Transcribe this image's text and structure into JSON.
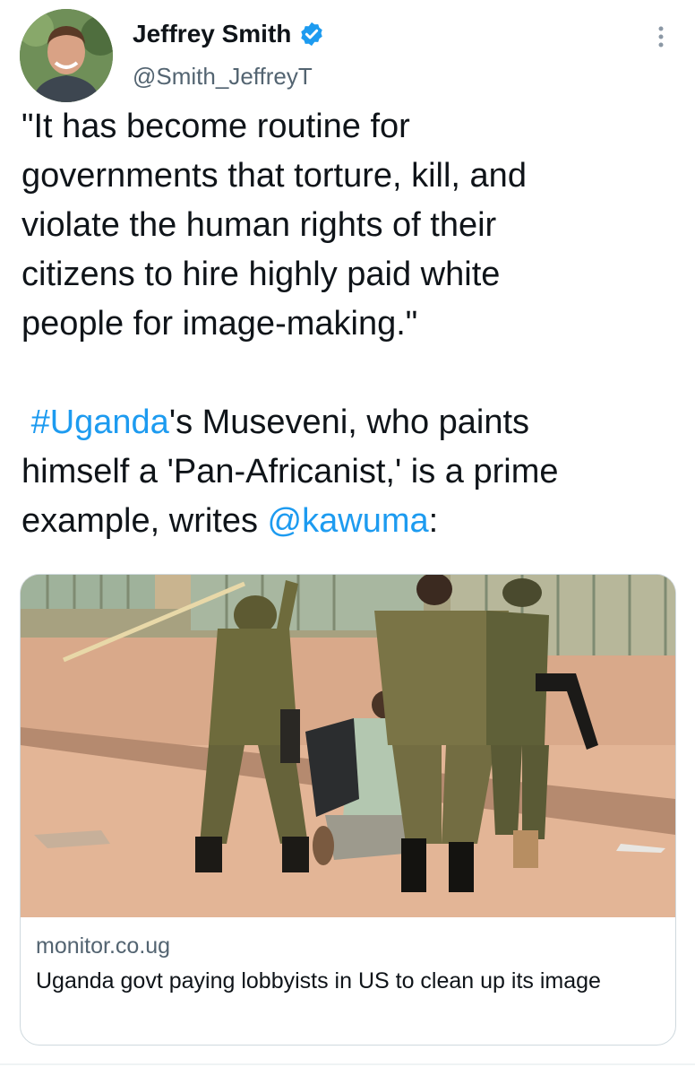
{
  "author": {
    "display_name": "Jeffrey Smith",
    "handle": "@Smith_JeffreyT",
    "verified": true
  },
  "tweet": {
    "quote_lines": [
      "\"It has become routine for",
      "governments that torture, kill, and",
      "violate the human rights of their",
      "citizens to hire highly paid white",
      "people for image-making.\""
    ],
    "hashtag": "#Uganda",
    "line1_after_hashtag": "'s Museveni, who paints",
    "line2": "himself a 'Pan-Africanist,' is a prime",
    "line3_before_mention": "example, writes ",
    "mention": "@kawuma",
    "line3_after_mention": ":"
  },
  "card": {
    "domain": "monitor.co.ug",
    "title": "Uganda govt paying lobbyists in US to clean up its image",
    "image_icon": "news-photo"
  },
  "icons": {
    "verified": "verified-badge-icon",
    "more": "more-options-icon"
  },
  "colors": {
    "link": "#1d9bf0",
    "text": "#0f1419",
    "secondary": "#536471",
    "border": "#cfd9de"
  }
}
